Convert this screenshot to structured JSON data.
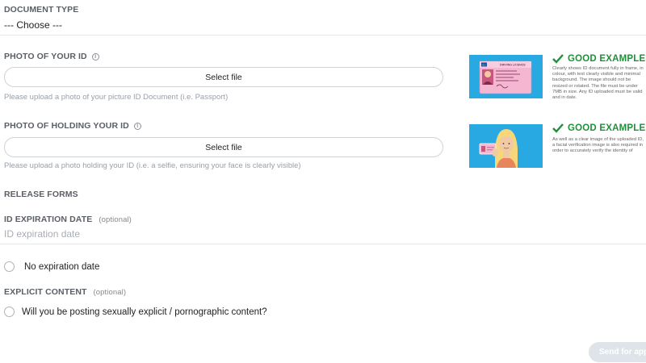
{
  "document_type": {
    "label": "DOCUMENT TYPE",
    "selected": "--- Choose ---"
  },
  "photo_id": {
    "label": "PHOTO OF YOUR ID",
    "button": "Select file",
    "help": "Please upload a photo of your picture ID Document (i.e. Passport)",
    "example_title": "GOOD EXAMPLE",
    "example_desc": "Clearly shows ID document fully in frame, in colour, with text clearly visible and minimal background. The image should not be resized or rotated. The file must be under 7MB in size. Any ID uploaded must be valid and in date.",
    "card_header": "DRIVING LICENCE",
    "card_region": "EU"
  },
  "holding_id": {
    "label": "PHOTO OF HOLDING YOUR ID",
    "button": "Select file",
    "help": "Please upload a photo holding your ID (i.e. a selfie, ensuring your face is clearly visible)",
    "example_title": "GOOD EXAMPLE",
    "example_desc": "As well as a clear image of the uploaded ID, a facial verification image is also required in order to accurately verify the identity of"
  },
  "release_forms": {
    "label": "RELEASE FORMS"
  },
  "id_expiration": {
    "label": "ID EXPIRATION DATE",
    "optional": "(optional)",
    "placeholder": "ID expiration date"
  },
  "no_expiration": {
    "label": "No expiration date"
  },
  "explicit_content": {
    "label": "EXPLICIT CONTENT",
    "optional": "(optional)",
    "question": "Will you be posting sexually explicit / pornographic content?"
  },
  "submit": {
    "label": "Send for app"
  },
  "colors": {
    "good_example_green": "#1f8f3a",
    "example_bg_blue": "#29a9e1",
    "submit_disabled": "#dfe4ea"
  }
}
